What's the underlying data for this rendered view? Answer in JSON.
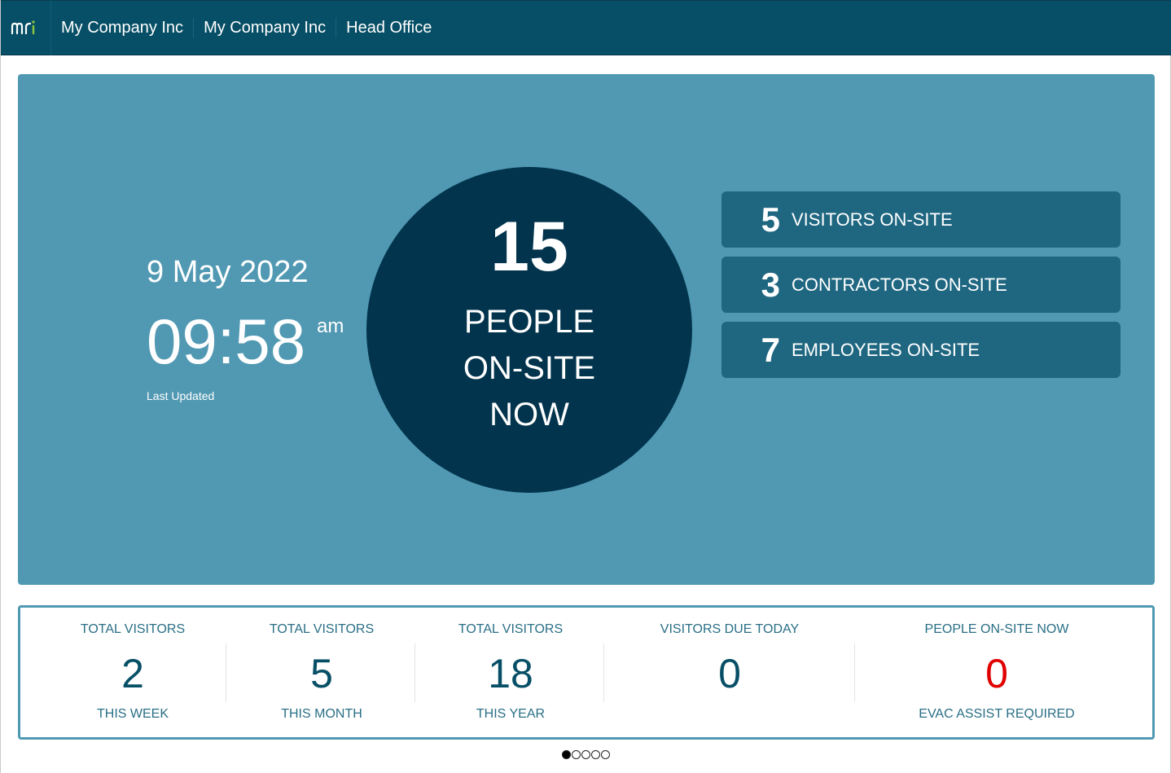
{
  "header": {
    "logo_icon": "mri-logo",
    "breadcrumbs": [
      "My Company Inc",
      "My Company Inc",
      "Head Office"
    ],
    "colors": {
      "bar": "#074f66"
    }
  },
  "hero": {
    "date": "9 May 2022",
    "time": "09:58",
    "ampm": "am",
    "last_updated_label": "Last Updated",
    "total_count": "15",
    "total_label_lines": [
      "PEOPLE",
      "ON-SITE",
      "NOW"
    ],
    "stats": [
      {
        "value": "5",
        "label": "VISITORS ON-SITE"
      },
      {
        "value": "3",
        "label": "CONTRACTORS ON-SITE"
      },
      {
        "value": "7",
        "label": "EMPLOYEES ON-SITE"
      }
    ],
    "colors": {
      "panel": "#5199b3",
      "circle": "#02344d",
      "card": "#1f6781"
    }
  },
  "summary": [
    {
      "heading": "TOTAL VISITORS",
      "value": "2",
      "sub": "THIS WEEK"
    },
    {
      "heading": "TOTAL VISITORS",
      "value": "5",
      "sub": "THIS MONTH"
    },
    {
      "heading": "TOTAL VISITORS",
      "value": "18",
      "sub": "THIS YEAR"
    },
    {
      "heading": "VISITORS DUE TODAY",
      "value": "0",
      "sub": ""
    },
    {
      "heading": "PEOPLE ON-SITE NOW",
      "value": "0",
      "sub": "EVAC ASSIST REQUIRED",
      "alert_color": "#e00000"
    }
  ],
  "pager": {
    "pages": 5,
    "active": 1
  }
}
